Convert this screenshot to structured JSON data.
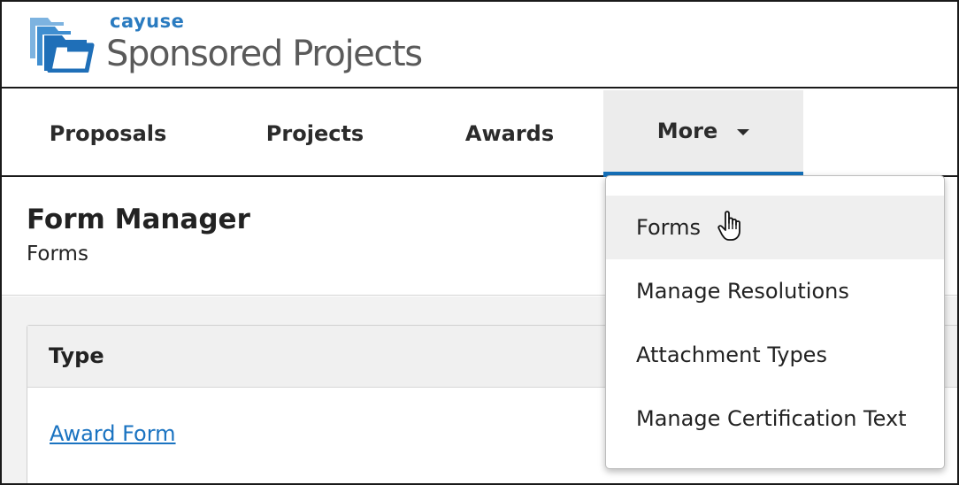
{
  "brand": {
    "company": "cayuse",
    "product": "Sponsored Projects",
    "accent_color": "#2a7bc0"
  },
  "nav": {
    "items": [
      {
        "label": "Proposals"
      },
      {
        "label": "Projects"
      },
      {
        "label": "Awards"
      },
      {
        "label": "More",
        "active": true,
        "icon": "caret-down-icon"
      }
    ],
    "active_color": "#1570b9"
  },
  "page": {
    "title": "Form Manager",
    "subtitle": "Forms"
  },
  "table": {
    "columns": [
      "Type"
    ],
    "rows": [
      {
        "type": "Award Form"
      }
    ],
    "link_color": "#1a73c1"
  },
  "dropdown": {
    "items": [
      {
        "label": "Forms",
        "hovered": true
      },
      {
        "label": "Manage Resolutions"
      },
      {
        "label": "Attachment Types"
      },
      {
        "label": "Manage Certification Text"
      }
    ]
  }
}
